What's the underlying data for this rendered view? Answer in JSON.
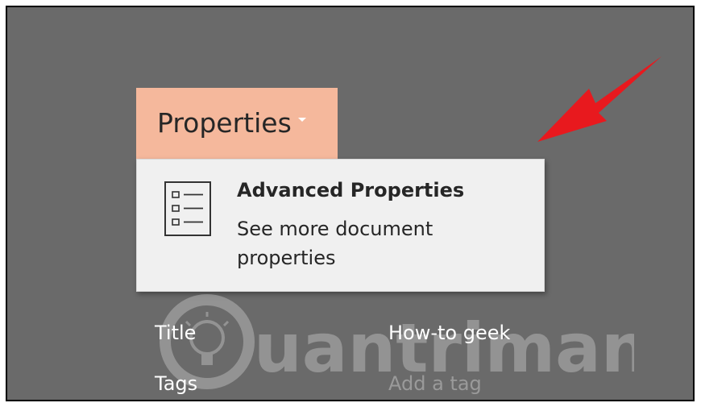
{
  "properties_menu": {
    "button_label": "Properties",
    "items": [
      {
        "title": "Advanced Properties",
        "description": "See more document properties",
        "icon": "properties-list-icon"
      }
    ]
  },
  "fields": {
    "title_label": "Title",
    "title_value": "How-to geek",
    "tags_label": "Tags",
    "tags_placeholder": "Add a tag"
  },
  "annotation": {
    "arrow_color": "#e8191e"
  },
  "watermark": {
    "text": "Quantrimang"
  },
  "colors": {
    "background": "#6a6a6a",
    "button_highlight": "#f5b89c",
    "menu_background": "#f0f0f0"
  }
}
